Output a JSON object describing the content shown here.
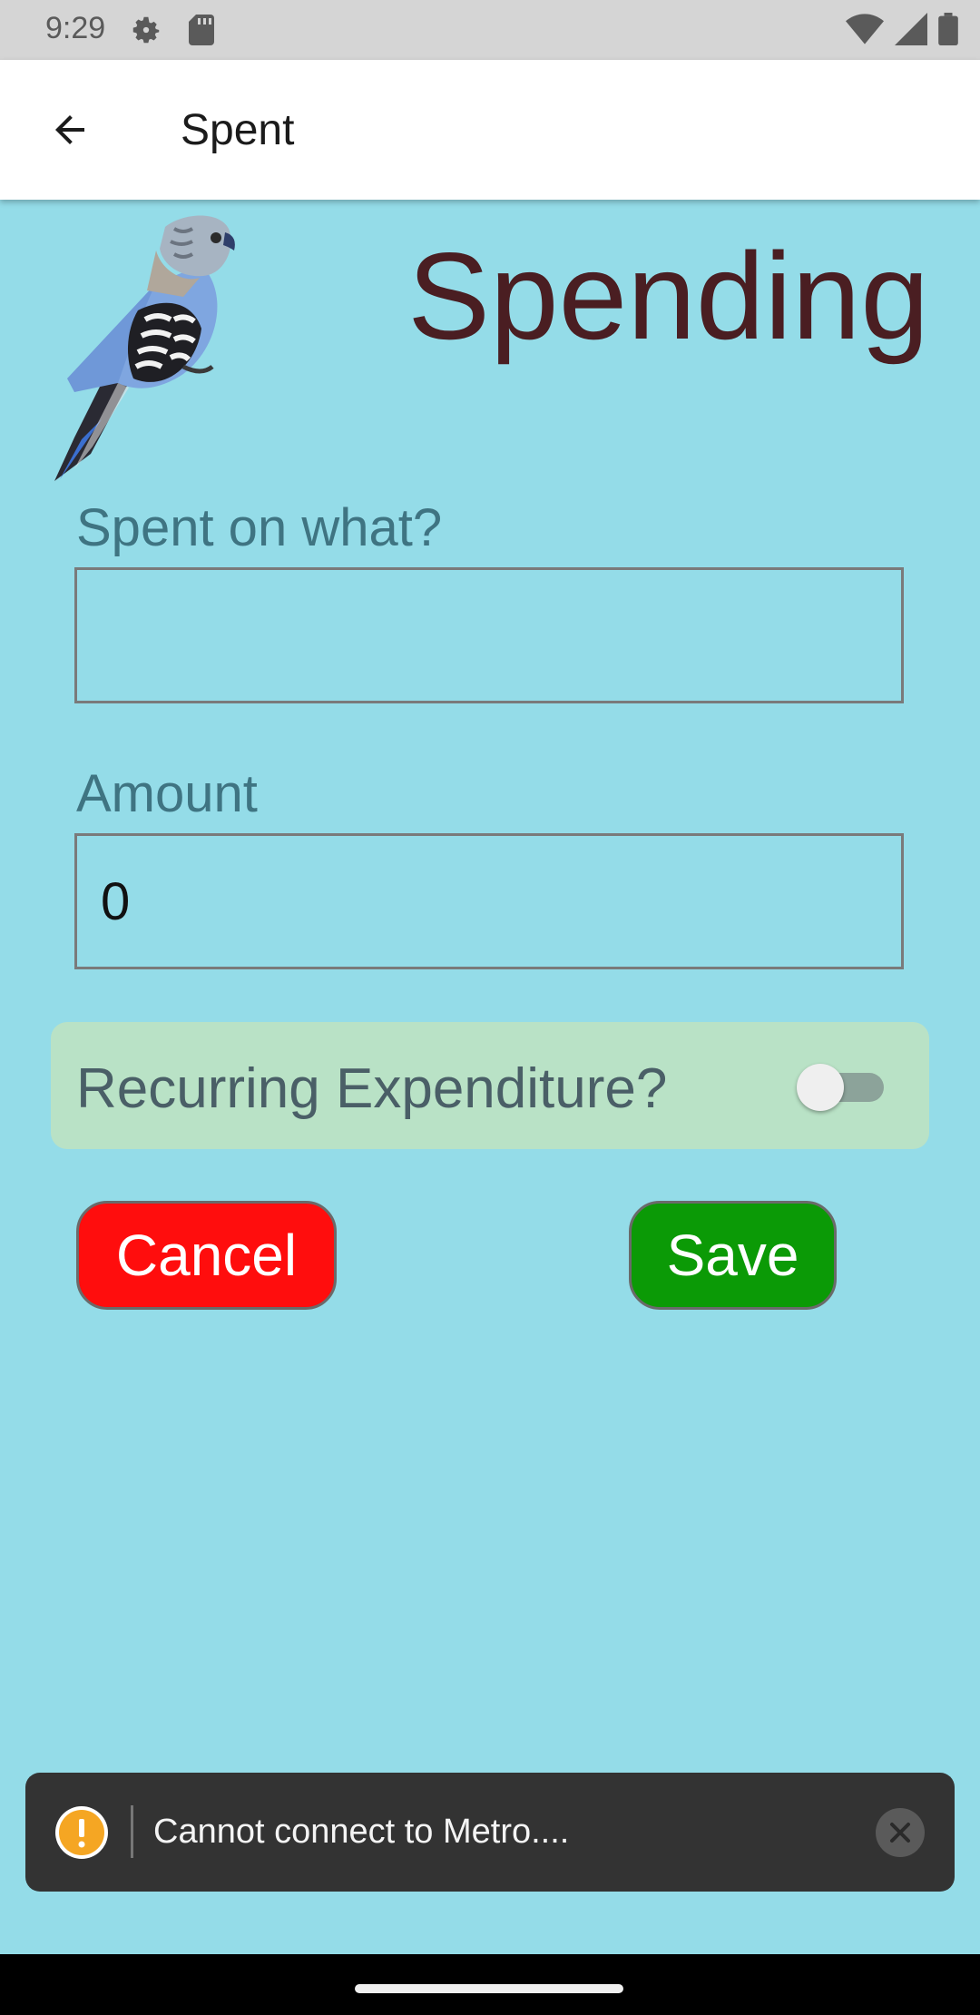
{
  "status_bar": {
    "time": "9:29",
    "icons": [
      "settings-gear-icon",
      "sd-card-icon",
      "wifi-icon",
      "cell-signal-icon",
      "battery-icon"
    ]
  },
  "app_bar": {
    "back_icon": "arrow-left-icon",
    "title": "Spent"
  },
  "page": {
    "heading": "Spending",
    "logo": "parakeet-logo"
  },
  "form": {
    "description_label": "Spent on what?",
    "description_value": "",
    "amount_label": "Amount",
    "amount_value": "0",
    "recurring_label": "Recurring Expenditure?",
    "recurring_on": false
  },
  "buttons": {
    "cancel_label": "Cancel",
    "save_label": "Save"
  },
  "toast": {
    "icon": "warning-icon",
    "message": "Cannot connect to Metro....",
    "close_icon": "close-icon"
  },
  "colors": {
    "background": "#94dce8",
    "heading": "#4a1e22",
    "cancel": "#ff0d0d",
    "save": "#0b9a06",
    "recurring_row": "#b9e2c6",
    "toast_bg": "#333333"
  }
}
